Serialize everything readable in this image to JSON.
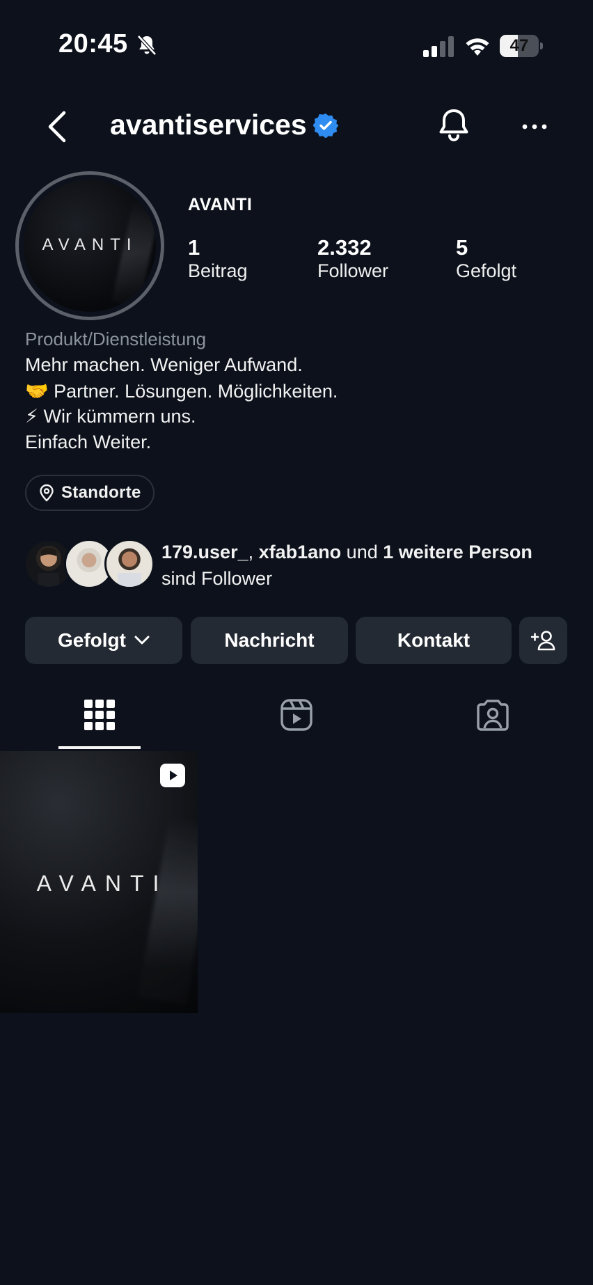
{
  "status_bar": {
    "time": "20:45",
    "battery": "47",
    "battery_level": 0.47
  },
  "header": {
    "username": "avantiservices"
  },
  "profile": {
    "avatar_logo": "AVANTI",
    "display_name": "AVANTI",
    "stats": [
      {
        "value": "1",
        "label": "Beitrag"
      },
      {
        "value": "2.332",
        "label": "Follower"
      },
      {
        "value": "5",
        "label": "Gefolgt"
      }
    ],
    "category": "Produkt/Dienstleistung",
    "bio": [
      "Mehr machen. Weniger Aufwand.",
      "🤝 Partner. Lösungen. Möglichkeiten.",
      "⚡ Wir kümmern uns.",
      "Einfach Weiter."
    ],
    "location_label": "Standorte"
  },
  "mutual": {
    "user1": "179.user_",
    "sep": ", ",
    "user2": "xfab1ano",
    "and": " und ",
    "others": "1 weitere Person",
    "suffix": "sind Follower"
  },
  "actions": {
    "following": "Gefolgt",
    "message": "Nachricht",
    "contact": "Kontakt"
  },
  "tabs": [
    "grid",
    "reels",
    "tagged"
  ],
  "posts": [
    {
      "logo": "AVANTI",
      "type": "reel"
    }
  ],
  "colors": {
    "background": "#0c111b",
    "button": "#242a33",
    "verified": "#2f8cf1",
    "secondary_text": "#8c939e"
  }
}
